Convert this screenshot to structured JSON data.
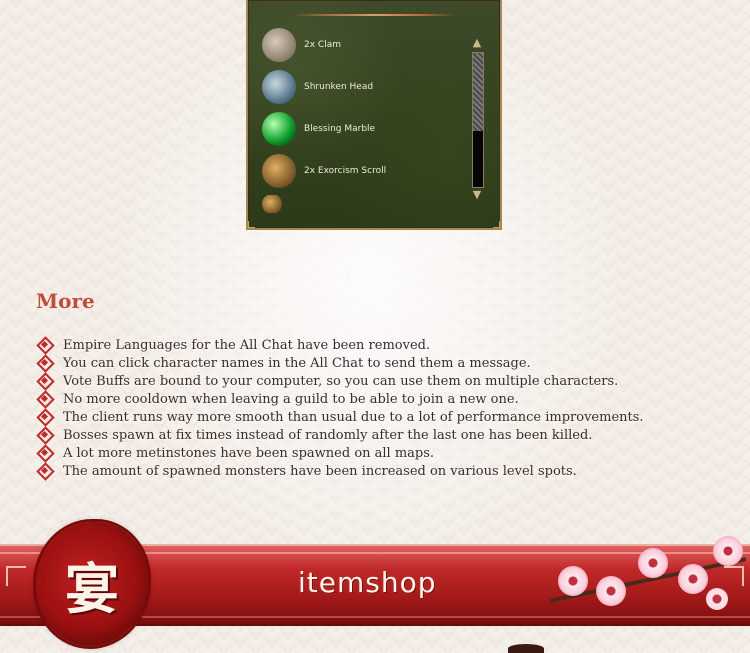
{
  "inventory": {
    "items": [
      {
        "label": "2x Clam",
        "icon": "clam-icon"
      },
      {
        "label": "Shrunken Head",
        "icon": "shrunken-head-icon"
      },
      {
        "label": "Blessing Marble",
        "icon": "blessing-marble-icon"
      },
      {
        "label": "2x Exorcism Scroll",
        "icon": "exorcism-scroll-icon"
      }
    ],
    "scroll_up": "▲",
    "scroll_down": "▼"
  },
  "more": {
    "title": "More",
    "items": [
      "Empire Languages for the All Chat have been removed.",
      "You can click character names in the All Chat to send them a message.",
      "Vote Buffs are bound to your computer, so you can use them on multiple characters.",
      "No more cooldown when leaving a guild to be able to join a new one.",
      "The client runs way more smooth than usual due to a lot of performance improvements.",
      "Bosses spawn at fix times instead of randomly after the last one has been killed.",
      "A lot more metinstones have been spawned on all maps.",
      "The amount of spawned monsters have been increased on various level spots."
    ]
  },
  "banner": {
    "title": "itemshop",
    "seal_char": "宴"
  },
  "colors": {
    "accent": "#c04c3a",
    "banner_red": "#c02828",
    "text": "#3a2a2a"
  }
}
